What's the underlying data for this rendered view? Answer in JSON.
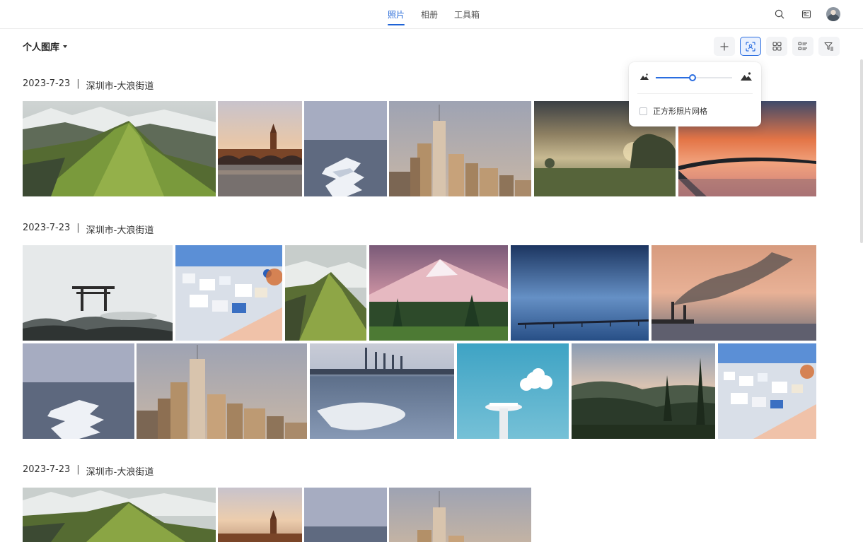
{
  "tabs": [
    {
      "label": "照片",
      "active": true
    },
    {
      "label": "相册",
      "active": false
    },
    {
      "label": "工具箱",
      "active": false
    }
  ],
  "top_icons": [
    "search-icon",
    "id-card-icon",
    "avatar"
  ],
  "library": {
    "title": "个人图库"
  },
  "toolbar": {
    "buttons": [
      "plus-icon",
      "face-scan-icon",
      "grid-view-icon",
      "list-view-icon",
      "filter-icon"
    ],
    "active": "face-scan-icon"
  },
  "popover": {
    "size_level_percent": 48,
    "square_grid_label": "正方形照片网格",
    "square_grid_checked": false
  },
  "sections": [
    {
      "date": "2023-7-23",
      "separator": "|",
      "location": "深圳市-大浪街道",
      "photos": [
        "green-mountain-ridge",
        "big-ben-sunset",
        "ice-steps-sea",
        "world-trade-center",
        "misty-field-sunset",
        "bridge-fiery-sky"
      ]
    },
    {
      "date": "2023-7-23",
      "separator": "|",
      "location": "深圳市-大浪街道",
      "photos": [
        "torii-gate-sea",
        "santorini-village",
        "green-mountain-ridge-small",
        "snowy-volcano",
        "blue-pier",
        "smokestack-sunset",
        "ice-steps-sea",
        "world-trade-center",
        "frozen-lake-factory",
        "water-tower-cloud",
        "forest-valley",
        "santorini-village"
      ]
    },
    {
      "date": "2023-7-23",
      "separator": "|",
      "location": "深圳市-大浪街道",
      "photos": [
        "green-mountain-ridge",
        "big-ben-sunset",
        "ice-steps-sea",
        "world-trade-center"
      ]
    }
  ]
}
